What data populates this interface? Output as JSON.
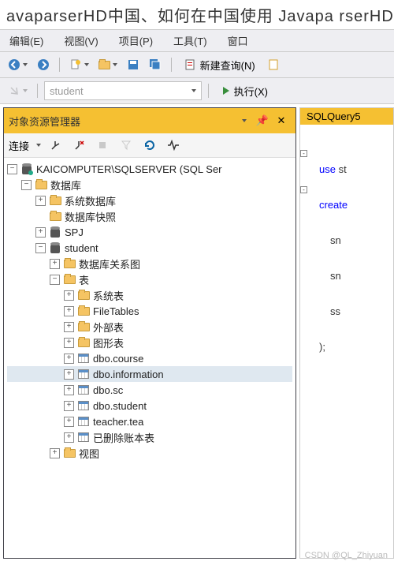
{
  "title": "avaparserHD中国、如何在中国使用 Javapa rserHD?",
  "menu": [
    "编辑(E)",
    "视图(V)",
    "项目(P)",
    "工具(T)",
    "窗口"
  ],
  "toolbar": {
    "new_query": "新建查询(N)",
    "combo_text": "student",
    "execute": "执行(X)"
  },
  "panel": {
    "title": "对象资源管理器",
    "connect": "连接"
  },
  "tree": {
    "server": "KAICOMPUTER\\SQLSERVER (SQL Ser",
    "databases": "数据库",
    "sys_db": "系统数据库",
    "db_snap": "数据库快照",
    "spj": "SPJ",
    "student": "student",
    "db_diagram": "数据库关系图",
    "tables": "表",
    "sys_tables": "系统表",
    "file_tables": "FileTables",
    "ext_tables": "外部表",
    "graph_tables": "图形表",
    "t_course": "dbo.course",
    "t_info": "dbo.information",
    "t_sc": "dbo.sc",
    "t_student": "dbo.student",
    "t_teacher": "teacher.tea",
    "t_deleted": "已删除账本表",
    "views": "视图"
  },
  "editor": {
    "tab": "SQLQuery5",
    "l1a": "use",
    "l1b": " st",
    "l2a": "create",
    "l2b": "",
    "l3": "sn",
    "l4": "sn",
    "l5": "ss",
    "l6": ");"
  },
  "watermark": "CSDN @QL_Zhiyuan"
}
